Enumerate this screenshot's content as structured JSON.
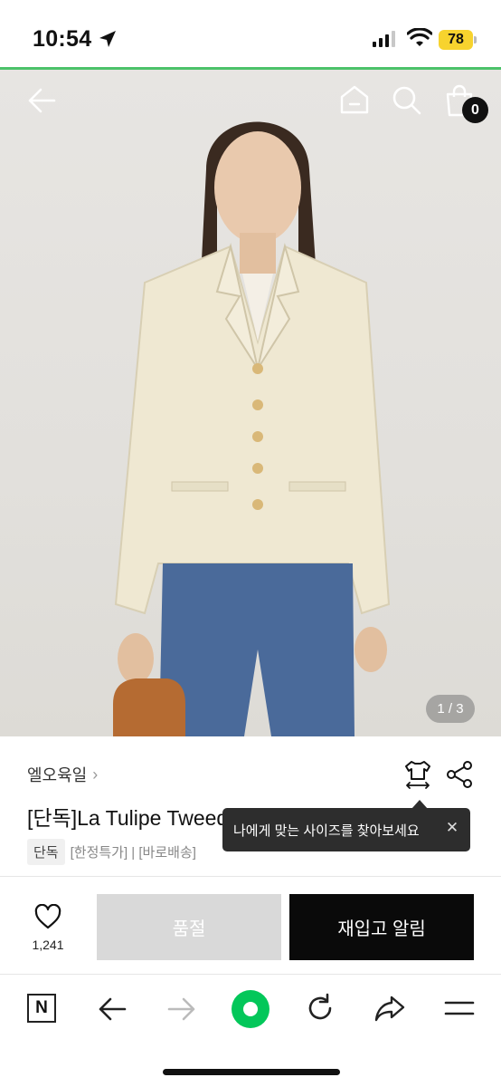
{
  "status_bar": {
    "time": "10:54",
    "battery": "78",
    "icons": [
      "location-arrow-icon",
      "signal-icon",
      "wifi-icon",
      "battery-icon"
    ]
  },
  "colors": {
    "accent_green": "#4cc26a",
    "battery_yellow": "#f7d32e",
    "primary_black": "#0a0a0a",
    "disabled_gray": "#d9d9d9",
    "naver_green": "#03c75a"
  },
  "header": {
    "back_icon": "back-arrow-icon",
    "home_icon": "home-icon",
    "search_icon": "search-icon",
    "cart_icon": "cart-icon",
    "cart_count": "0"
  },
  "gallery": {
    "counter": "1 / 3"
  },
  "product": {
    "brand": "엘오육일",
    "title": "[단독]La Tulipe Tweed Jacket_Ivory",
    "tag_exclusive": "단독",
    "tags_text": "[한정특가] | [바로배송]"
  },
  "tooltip": {
    "text": "나에게 맞는 사이즈를 찾아보세요",
    "close": "✕"
  },
  "actions": {
    "like_count": "1,241",
    "soldout_label": "품절",
    "restock_label": "재입고 알림"
  },
  "browser_toolbar": {
    "n_label": "N",
    "items": [
      "naver-home-icon",
      "back-icon",
      "forward-icon",
      "green-dot-icon",
      "reload-icon",
      "share-icon",
      "menu-icon"
    ]
  }
}
